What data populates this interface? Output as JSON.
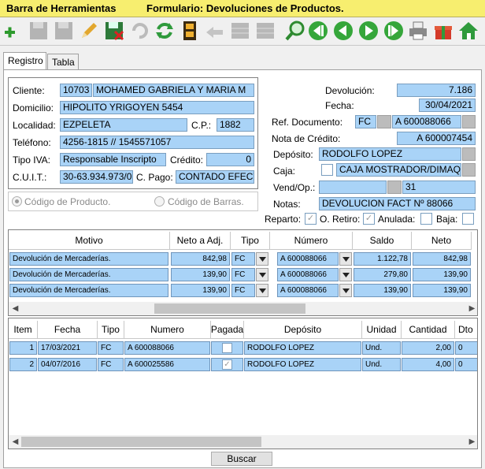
{
  "titlebar": {
    "title": "Barra de Herramientas",
    "form": "Formulario: Devoluciones de Productos."
  },
  "toolbar": {
    "icons": [
      "add-icon",
      "save-disabled-icon",
      "save-disabled-icon",
      "edit-icon",
      "save-red-icon",
      "undo-disabled-icon",
      "refresh-icon",
      "film-icon",
      "back-disabled-icon",
      "grid-disabled-icon",
      "grid-disabled-icon",
      "search-icon",
      "first-icon",
      "prev-icon",
      "next-icon",
      "last-icon",
      "print-icon",
      "gift-icon",
      "home-icon"
    ]
  },
  "tabs": [
    "Registro",
    "Tabla"
  ],
  "cliente": {
    "label_cliente": "Cliente:",
    "cliente_code": "10703",
    "cliente_name": "MOHAMED GABRIELA Y MARIA M",
    "label_domicilio": "Domicilio:",
    "domicilio": "HIPOLITO YRIGOYEN 5454",
    "label_localidad": "Localidad:",
    "localidad": "EZPELETA",
    "label_cp": "C.P.:",
    "cp": "1882",
    "label_telefono": "Teléfono:",
    "telefono": "4256-1815 // 1545571057",
    "label_iva": "Tipo IVA:",
    "iva": "Responsable Inscripto",
    "label_credito": "Crédito:",
    "credito": "0",
    "label_cuit": "C.U.I.T.:",
    "cuit": "30-63.934.973/0",
    "label_cpago": "C. Pago:",
    "cpago": "CONTADO EFECTIVO"
  },
  "opciones": {
    "codigo_producto": "Código de Producto.",
    "codigo_barras": "Código de Barras."
  },
  "doc": {
    "label_devolucion": "Devolución:",
    "devolucion": "7.186",
    "label_fecha": "Fecha:",
    "fecha": "30/04/2021",
    "label_ref": "Ref. Documento:",
    "ref_tipo": "FC",
    "ref_num": "A   600088066",
    "label_nota": "Nota de Crédito:",
    "nota": "A  600007454",
    "label_deposito": "Depósito:",
    "deposito": "RODOLFO LOPEZ",
    "label_caja": "Caja:",
    "caja": "CAJA MOSTRADOR/DIMAQ",
    "label_vend": "Vend/Op.:",
    "vend": "31",
    "label_notas": "Notas:",
    "notas": "DEVOLUCION FACT Nº 88066",
    "label_reparto": "Reparto:",
    "label_oretiro": "O. Retiro:",
    "label_anulada": "Anulada:",
    "label_baja": "Baja:"
  },
  "grid1": {
    "headers": [
      "Motivo",
      "Neto a Adj.",
      "Tipo",
      "Número",
      "Saldo",
      "Neto"
    ],
    "rows": [
      [
        "Devolución de Mercaderías.",
        "842,98",
        "FC",
        "A   600088066",
        "1.122,78",
        "842,98"
      ],
      [
        "Devolución de Mercaderías.",
        "139,90",
        "FC",
        "A   600088066",
        "279,80",
        "139,90"
      ],
      [
        "Devolución de Mercaderías.",
        "139,90",
        "FC",
        "A   600088066",
        "139,90",
        "139,90"
      ]
    ]
  },
  "grid2": {
    "headers": [
      "Item",
      "Fecha",
      "Tipo",
      "Numero",
      "Pagada",
      "Depósito",
      "Unidad",
      "Cantidad",
      "Dto"
    ],
    "rows": [
      [
        "1",
        "17/03/2021",
        "FC",
        "A   600088066",
        "",
        "RODOLFO LOPEZ",
        "Und.",
        "2,00",
        "0"
      ],
      [
        "2",
        "04/07/2016",
        "FC",
        "A   600025586",
        "",
        "RODOLFO LOPEZ",
        "Und.",
        "4,00",
        "0"
      ]
    ]
  },
  "buscar_label": "Buscar"
}
